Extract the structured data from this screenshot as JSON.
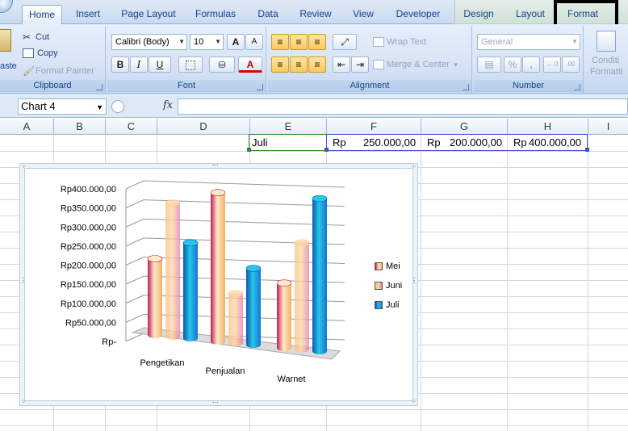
{
  "tabs": [
    {
      "label": "Home"
    },
    {
      "label": "Insert"
    },
    {
      "label": "Page Layout"
    },
    {
      "label": "Formulas"
    },
    {
      "label": "Data"
    },
    {
      "label": "Review"
    },
    {
      "label": "View"
    },
    {
      "label": "Developer"
    },
    {
      "label": "Design"
    },
    {
      "label": "Layout"
    },
    {
      "label": "Format"
    }
  ],
  "ribbon": {
    "clipboard": {
      "paste": "aste",
      "cut": "Cut",
      "copy": "Copy",
      "format_painter": "Format Painter",
      "label": "Clipboard"
    },
    "font": {
      "family": "Calibri (Body)",
      "size": "10",
      "bold": "B",
      "italic": "I",
      "underline": "U",
      "font_color_glyph": "A",
      "grow": "A",
      "shrink": "A",
      "label": "Font"
    },
    "alignment": {
      "wrap_text": "Wrap Text",
      "merge_center": "Merge & Center",
      "label": "Alignment"
    },
    "number": {
      "format": "General",
      "percent": "%",
      "comma": ",",
      "label": "Number"
    },
    "styles": {
      "conditional_line1": "Conditi",
      "conditional_line2": "Formatti"
    }
  },
  "formula_bar": {
    "name_box": "Chart 4",
    "fx": "fx",
    "content": ""
  },
  "columns": [
    "A",
    "B",
    "C",
    "D",
    "E",
    "F",
    "G",
    "H",
    "I"
  ],
  "row": {
    "e": "Juli",
    "f_prefix": "Rp",
    "f_value": "250.000,00",
    "g_prefix": "Rp",
    "g_value": "200.000,00",
    "h_prefix": "Rp",
    "h_value": "400.000,00"
  },
  "chart_data": {
    "type": "bar",
    "style": "3d-cylinder-clustered",
    "title": "",
    "categories": [
      "Pengetikan",
      "Penjualan",
      "Warnet"
    ],
    "series": [
      {
        "name": "Mei",
        "values": [
          200000,
          390000,
          170000
        ]
      },
      {
        "name": "Juni",
        "values": [
          350000,
          130000,
          280000
        ]
      },
      {
        "name": "Juli",
        "values": [
          250000,
          200000,
          400000
        ]
      }
    ],
    "y_tick_labels": [
      "Rp-",
      "Rp50.000,00",
      "Rp100.000,00",
      "Rp150.000,00",
      "Rp200.000,00",
      "Rp250.000,00",
      "Rp300.000,00",
      "Rp350.000,00",
      "Rp400.000,00"
    ],
    "ylim": [
      0,
      400000
    ],
    "legend_position": "right",
    "grid": true,
    "colors": {
      "Mei": "#c21b55",
      "Juni": "#ee9a3a",
      "Juli": "#1f7fd8"
    }
  }
}
